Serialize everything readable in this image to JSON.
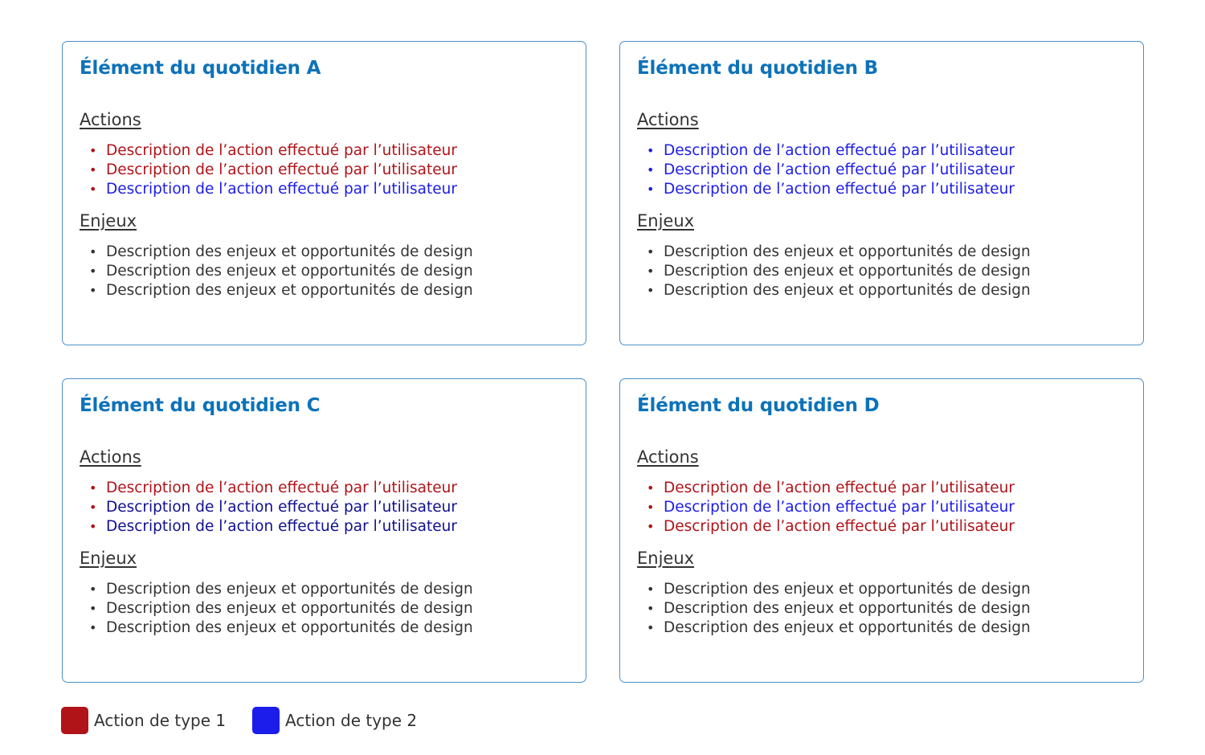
{
  "colors": {
    "title": "#0d72b9",
    "border": "#4a90c8",
    "type1": "#b01318",
    "type2": "#1c1ceb",
    "type2_dark": "#10108f",
    "text": "#333333"
  },
  "cards": [
    {
      "title": "Élément du quotidien A",
      "actions_label": "Actions",
      "actions": [
        {
          "text": "Description de l’action effectué par l’utilisateur",
          "type": "type1",
          "text_color": "#b01318",
          "bullet_color": "#b01318"
        },
        {
          "text": "Description de l’action effectué par l’utilisateur",
          "type": "type1",
          "text_color": "#b01318",
          "bullet_color": "#b01318"
        },
        {
          "text": "Description de l’action effectué par l’utilisateur",
          "type": "type2",
          "text_color": "#1c1ceb",
          "bullet_color": "#b01318"
        }
      ],
      "enjeux_label": "Enjeux",
      "enjeux": [
        "Description des enjeux et opportunités de design",
        "Description des enjeux et opportunités de design",
        "Description des enjeux et opportunités de design"
      ]
    },
    {
      "title": "Élément du quotidien B",
      "actions_label": "Actions",
      "actions": [
        {
          "text": "Description de l’action effectué par l’utilisateur",
          "type": "type2",
          "text_color": "#1c1ceb",
          "bullet_color": "#1c1ceb"
        },
        {
          "text": "Description de l’action effectué par l’utilisateur",
          "type": "type2",
          "text_color": "#1c1ceb",
          "bullet_color": "#1c1ceb"
        },
        {
          "text": "Description de l’action effectué par l’utilisateur",
          "type": "type2",
          "text_color": "#1c1ceb",
          "bullet_color": "#1c1ceb"
        }
      ],
      "enjeux_label": "Enjeux",
      "enjeux": [
        "Description des enjeux et opportunités de design",
        "Description des enjeux et opportunités de design",
        "Description des enjeux et opportunités de design"
      ]
    },
    {
      "title": "Élément du quotidien C",
      "actions_label": "Actions",
      "actions": [
        {
          "text": "Description de l’action effectué par l’utilisateur",
          "type": "type1",
          "text_color": "#b01318",
          "bullet_color": "#b01318"
        },
        {
          "text": "Description de l’action effectué par l’utilisateur",
          "type": "type2",
          "text_color": "#10108f",
          "bullet_color": "#b01318"
        },
        {
          "text": "Description de l’action effectué par l’utilisateur",
          "type": "type2",
          "text_color": "#10108f",
          "bullet_color": "#b01318"
        }
      ],
      "enjeux_label": "Enjeux",
      "enjeux": [
        "Description des enjeux et opportunités de design",
        "Description des enjeux et opportunités de design",
        "Description des enjeux et opportunités de design"
      ]
    },
    {
      "title": "Élément du quotidien D",
      "actions_label": "Actions",
      "actions": [
        {
          "text": "Description de l’action effectué par l’utilisateur",
          "type": "type1",
          "text_color": "#b01318",
          "bullet_color": "#b01318"
        },
        {
          "text": "Description de l’action effectué par l’utilisateur",
          "type": "type2",
          "text_color": "#1c1ceb",
          "bullet_color": "#b01318"
        },
        {
          "text": "Description de l’action effectué par l’utilisateur",
          "type": "type1",
          "text_color": "#b01318",
          "bullet_color": "#b01318"
        }
      ],
      "enjeux_label": "Enjeux",
      "enjeux": [
        "Description des enjeux et opportunités de design",
        "Description des enjeux et opportunités de design",
        "Description des enjeux et opportunités de design"
      ]
    }
  ],
  "legend": [
    {
      "label": "Action de type 1",
      "color": "#b01318"
    },
    {
      "label": "Action de type 2",
      "color": "#1c1ceb"
    }
  ]
}
